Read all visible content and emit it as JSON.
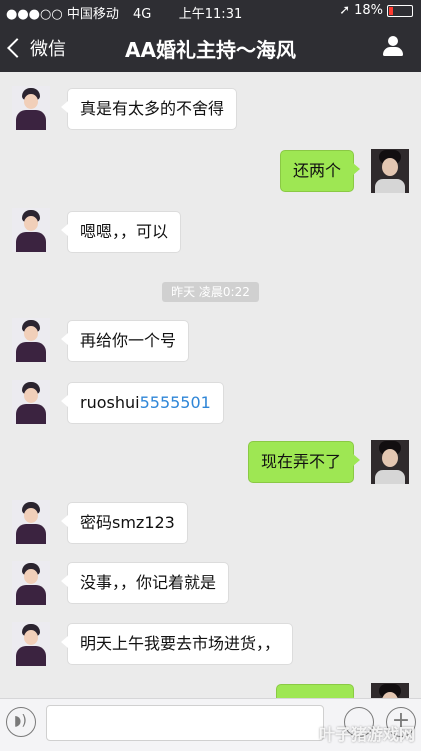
{
  "status_bar": {
    "carrier": "●●●○○ 中国移动",
    "network": "4G",
    "time": "上午11:31",
    "location_icon": "location-arrow-icon",
    "battery_percent": "18%",
    "battery_level": 0.18,
    "battery_color": "#ff3b30"
  },
  "nav": {
    "back_label": "微信",
    "title": "AA婚礼主持～海风",
    "profile_icon": "person-icon",
    "bar_color": "#2e2e33"
  },
  "timestamp": "昨天 凌晨0:22",
  "messages": [
    {
      "side": "left",
      "text": "真是有太多的不舍得"
    },
    {
      "side": "right",
      "text": "还两个"
    },
    {
      "side": "left",
      "text": "嗯嗯，，可以"
    },
    {
      "side": "left",
      "text": "再给你一个号"
    },
    {
      "side": "left",
      "text_prefix": "ruoshui",
      "text_link": "5555501"
    },
    {
      "side": "right",
      "text": "现在弄不了"
    },
    {
      "side": "left",
      "text": "密码smz123"
    },
    {
      "side": "left",
      "text": "没事，，你记着就是"
    },
    {
      "side": "left",
      "text": "明天上午我要去市场进货，，"
    },
    {
      "side": "right",
      "text": ""
    }
  ],
  "input_bar": {
    "voice_icon": "voice-icon",
    "emoji_icon": "emoji-icon",
    "plus_icon": "plus-icon",
    "input_value": ""
  },
  "watermark": "叶子猪游戏网",
  "colors": {
    "my_bubble": "#9ee753",
    "their_bubble": "#ffffff",
    "link": "#2f86d7",
    "background": "#ebebeb"
  }
}
